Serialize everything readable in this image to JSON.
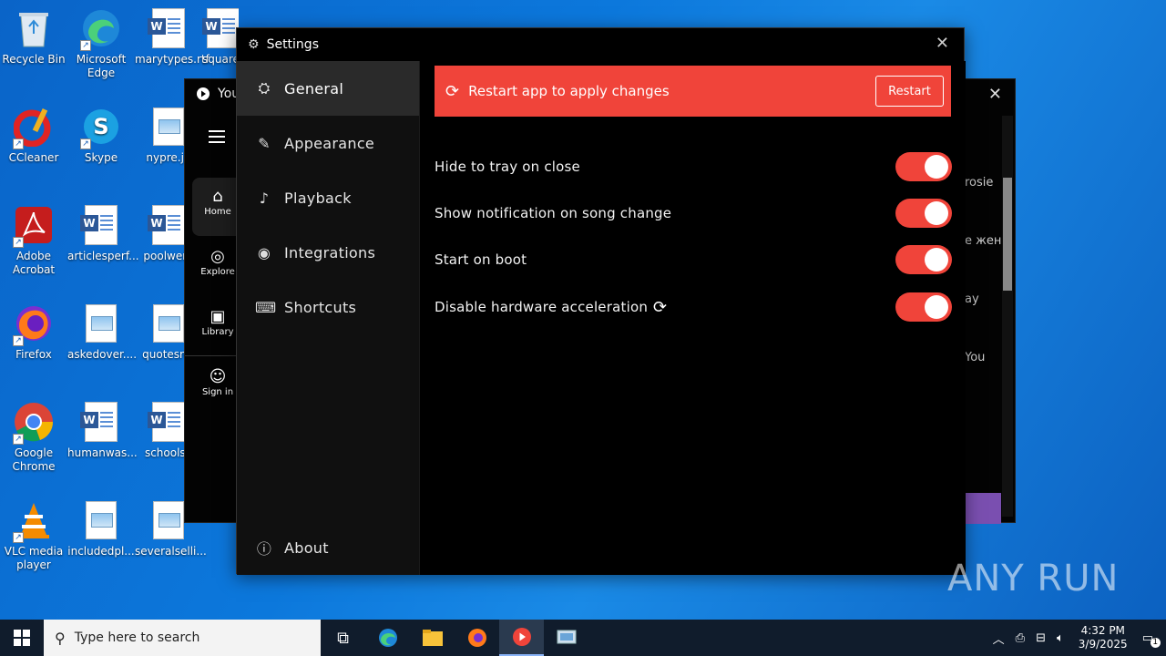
{
  "desktop": {
    "icons": [
      {
        "label": "Recycle Bin"
      },
      {
        "label": "Microsoft Edge"
      },
      {
        "label": "marytypes.rtf"
      },
      {
        "label": "square"
      },
      {
        "label": "CCleaner"
      },
      {
        "label": "Skype"
      },
      {
        "label": "nypre.jp"
      },
      {
        "label": "Adobe Acrobat"
      },
      {
        "label": "articlesperf..."
      },
      {
        "label": "poolwent"
      },
      {
        "label": "Firefox"
      },
      {
        "label": "askedover...."
      },
      {
        "label": "quotesret"
      },
      {
        "label": "Google Chrome"
      },
      {
        "label": "humanwas..."
      },
      {
        "label": "schoolse"
      },
      {
        "label": "VLC media player"
      },
      {
        "label": "includedpl..."
      },
      {
        "label": "severalselli..."
      }
    ]
  },
  "bg_window": {
    "title": "You",
    "nav": [
      {
        "label": "Home"
      },
      {
        "label": "Explore"
      },
      {
        "label": "Library"
      },
      {
        "label": "Sign in"
      }
    ],
    "side_texts": [
      "rosie",
      "е жен",
      "ay",
      "You"
    ]
  },
  "settings": {
    "title": "Settings",
    "sidebar": [
      {
        "label": "General"
      },
      {
        "label": "Appearance"
      },
      {
        "label": "Playback"
      },
      {
        "label": "Integrations"
      },
      {
        "label": "Shortcuts"
      }
    ],
    "about_label": "About",
    "banner": {
      "text": "Restart app to apply changes",
      "button": "Restart",
      "color": "#f0443a"
    },
    "options": [
      {
        "label": "Hide to tray on close",
        "enabled": true
      },
      {
        "label": "Show notification on song change",
        "enabled": true
      },
      {
        "label": "Start on boot",
        "enabled": true
      },
      {
        "label": "Disable hardware acceleration",
        "enabled": true
      }
    ]
  },
  "watermark": "ANY RUN",
  "taskbar": {
    "search_placeholder": "Type here to search",
    "time": "4:32 PM",
    "date": "3/9/2025",
    "notification_count": "1"
  }
}
